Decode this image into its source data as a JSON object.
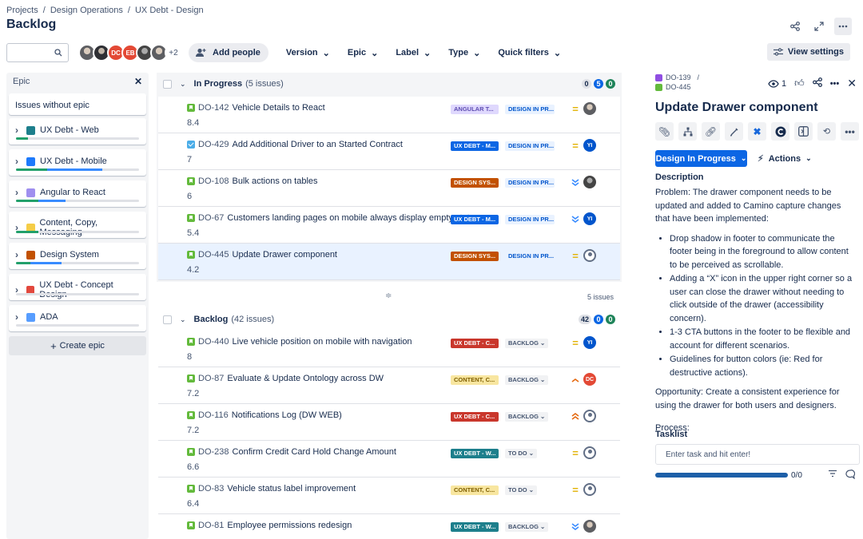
{
  "breadcrumb": [
    "Projects",
    "Design Operations",
    "UX Debt - Design"
  ],
  "page_title": "Backlog",
  "toolbar": {
    "avatars": [
      {
        "initials": "",
        "style": "photo"
      },
      {
        "initials": "",
        "style": "photo2"
      },
      {
        "initials": "DC",
        "color": "#E34935"
      },
      {
        "initials": "EB",
        "color": "#E34935"
      },
      {
        "initials": "",
        "style": "photo3"
      },
      {
        "initials": "",
        "style": "photo"
      }
    ],
    "avatars_more": "+2",
    "add_people": "Add people",
    "filters": [
      "Version",
      "Epic",
      "Label",
      "Type",
      "Quick filters"
    ],
    "view_settings": "View settings"
  },
  "epic_panel": {
    "title": "Epic",
    "without_epic": "Issues without epic",
    "epics": [
      {
        "name": "UX Debt - Web",
        "color": "#1D7F8C",
        "green": 10,
        "blue": 0
      },
      {
        "name": "UX Debt - Mobile",
        "color": "#1D7AFC",
        "green": 25,
        "blue": 45
      },
      {
        "name": "Angular to React",
        "color": "#9F8FEF",
        "green": 18,
        "blue": 22
      },
      {
        "name": "Content, Copy, Messaging",
        "color": "#F5CD47",
        "green": 18,
        "blue": 0
      },
      {
        "name": "Design System",
        "color": "#C25100",
        "green": 12,
        "blue": 25
      },
      {
        "name": "UX Debt - Concept Design",
        "color": "#E2483D",
        "green": 0,
        "blue": 0
      },
      {
        "name": "ADA",
        "color": "#579DFF",
        "green": 0,
        "blue": 0
      }
    ],
    "create_epic": "Create epic"
  },
  "sprint": {
    "title": "In Progress",
    "count": "(5 issues)",
    "badges": [
      "0",
      "5",
      "0"
    ],
    "footer_count": "5 issues",
    "issues": [
      {
        "type": "story",
        "key": "DO-142",
        "summary": "Vehicle Details to React",
        "estimate": "8.4",
        "epic": "ANGULAR T...",
        "epic_bg": "#DFD8FD",
        "epic_fg": "#5E4DB2",
        "status": "DESIGN IN PR...",
        "status_style": "dip",
        "priority": "medium",
        "assignee": {
          "type": "photo"
        }
      },
      {
        "type": "task",
        "key": "DO-429",
        "summary": "Add Additional Driver to an Started Contract",
        "estimate": "7",
        "epic": "UX DEBT - M...",
        "epic_bg": "#0C66E4",
        "epic_fg": "#FFFFFF",
        "status": "DESIGN IN PR...",
        "status_style": "dip",
        "priority": "medium",
        "assignee": {
          "initials": "YI",
          "color": "#0055CC"
        }
      },
      {
        "type": "story",
        "key": "DO-108",
        "summary": "Bulk actions on tables",
        "estimate": "6",
        "epic": "DESIGN SYS...",
        "epic_bg": "#C25100",
        "epic_fg": "#FFFFFF",
        "status": "DESIGN IN PR...",
        "status_style": "dip",
        "priority": "low",
        "assignee": {
          "type": "photo3"
        }
      },
      {
        "type": "story",
        "key": "DO-67",
        "summary": "Customers landing pages on mobile always display empty state",
        "estimate": "5.4",
        "epic": "UX DEBT - M...",
        "epic_bg": "#0C66E4",
        "epic_fg": "#FFFFFF",
        "status": "DESIGN IN PR...",
        "status_style": "dip",
        "priority": "low",
        "assignee": {
          "initials": "YI",
          "color": "#0055CC"
        }
      },
      {
        "type": "story",
        "key": "DO-445",
        "summary": "Update Drawer component",
        "estimate": "4.2",
        "epic": "DESIGN SYS...",
        "epic_bg": "#C25100",
        "epic_fg": "#FFFFFF",
        "status": "DESIGN IN PR...",
        "status_style": "dip",
        "priority": "medium",
        "assignee": {
          "type": "unassigned"
        },
        "selected": true
      }
    ]
  },
  "backlog": {
    "title": "Backlog",
    "count": "(42 issues)",
    "badges": [
      "42",
      "0",
      "0"
    ],
    "issues": [
      {
        "type": "story",
        "key": "DO-440",
        "summary": "Live vehicle position on mobile with navigation",
        "estimate": "8",
        "epic": "UX DEBT - C...",
        "epic_bg": "#C9372C",
        "epic_fg": "#FFFFFF",
        "status": "BACKLOG ⌄",
        "status_style": "grey",
        "priority": "medium",
        "assignee": {
          "initials": "YI",
          "color": "#0055CC"
        }
      },
      {
        "type": "story",
        "key": "DO-87",
        "summary": "Evaluate & Update Ontology across DW",
        "estimate": "7.2",
        "epic": "CONTENT, C...",
        "epic_bg": "#F8E6A0",
        "epic_fg": "#7F5F01",
        "status": "BACKLOG ⌄",
        "status_style": "grey",
        "priority": "high",
        "assignee": {
          "initials": "DC",
          "color": "#E34935"
        }
      },
      {
        "type": "story",
        "key": "DO-116",
        "summary": "Notifications Log (DW WEB)",
        "estimate": "7.2",
        "epic": "UX DEBT - C...",
        "epic_bg": "#C9372C",
        "epic_fg": "#FFFFFF",
        "status": "BACKLOG ⌄",
        "status_style": "grey",
        "priority": "highest",
        "assignee": {
          "type": "unassigned"
        }
      },
      {
        "type": "story",
        "key": "DO-238",
        "summary": "Confirm Credit Card Hold Change Amount",
        "estimate": "6.6",
        "epic": "UX DEBT - W...",
        "epic_bg": "#1D7F8C",
        "epic_fg": "#FFFFFF",
        "status": "TO DO ⌄",
        "status_style": "grey",
        "priority": "medium",
        "assignee": {
          "type": "unassigned"
        }
      },
      {
        "type": "story",
        "key": "DO-83",
        "summary": "Vehicle status label improvement",
        "estimate": "6.4",
        "epic": "CONTENT, C...",
        "epic_bg": "#F8E6A0",
        "epic_fg": "#7F5F01",
        "status": "TO DO ⌄",
        "status_style": "grey",
        "priority": "medium",
        "assignee": {
          "type": "unassigned"
        }
      },
      {
        "type": "story",
        "key": "DO-81",
        "summary": "Employee permissions redesign",
        "estimate": "",
        "epic": "UX DEBT - W...",
        "epic_bg": "#1D7F8C",
        "epic_fg": "#FFFFFF",
        "status": "BACKLOG ⌄",
        "status_style": "grey",
        "priority": "low",
        "assignee": {
          "type": "photo"
        }
      }
    ]
  },
  "detail": {
    "parent_key": "DO-139",
    "parent_sep": "/",
    "key": "DO-445",
    "watchers": "1",
    "title": "Update Drawer component",
    "status_button": "Design In Progress",
    "actions": "Actions",
    "description_heading": "Description",
    "problem": "Problem: The drawer component needs to be updated and added to Camino capture changes that have been implemented:",
    "bullets": [
      "Drop shadow in footer to communicate the footer being in the foreground to allow content to be perceived as scrollable.",
      "Adding a “X” icon in the upper right corner so a user can close the drawer without needing to click outside of the drawer (accessibility concern).",
      "1-3 CTA buttons in the footer to be flexible and account for different scenarios.",
      "Guidelines for button colors (ie: Red for destructive actions)."
    ],
    "opportunity": "Opportunity: Create a consistent experience for using the drawer for both users and designers.",
    "process": "Process:",
    "tasklist_heading": "Tasklist",
    "tasklist_placeholder": "Enter task and hit enter!",
    "tasklist_progress": "0/0"
  }
}
